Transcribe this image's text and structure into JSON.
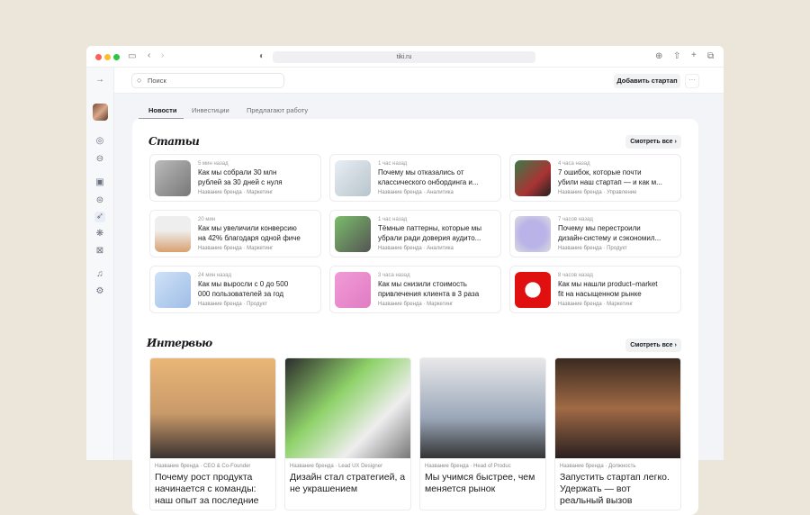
{
  "browser": {
    "url": "tiki.ru",
    "colors": {
      "close": "#ff5f57",
      "min": "#febc2e",
      "max": "#28c840"
    }
  },
  "topbar": {
    "search_placeholder": "Поиск",
    "add_startup": "Добавить стартап",
    "more": "···"
  },
  "tabs": [
    "Новости",
    "Инвестиции",
    "Предлагают работу"
  ],
  "articles": {
    "title": "Статьи",
    "see_all": "Смотреть все ›",
    "items": [
      {
        "time": "5 мин назад",
        "l1": "Как мы собрали 30 млн",
        "l2": "рублей за 30 дней с нуля",
        "brand": "Название бренда",
        "cat": "Маркетинг"
      },
      {
        "time": "1 час назад",
        "l1": "Почему мы отказались от",
        "l2": "классического онбординга и...",
        "brand": "Название бренда",
        "cat": "Аналитика"
      },
      {
        "time": "4 часа назад",
        "l1": "7 ошибок, которые почти",
        "l2": "убили наш стартап — и как м...",
        "brand": "Название бренда",
        "cat": "Управление"
      },
      {
        "time": "20 мин",
        "l1": "Как мы увеличили конверсию",
        "l2": "на 42% благодаря одной фиче",
        "brand": "Название бренда",
        "cat": "Маркетинг"
      },
      {
        "time": "1 час назад",
        "l1": "Тёмные паттерны, которые мы",
        "l2": "убрали ради доверия аудито...",
        "brand": "Название бренда",
        "cat": "Аналитика"
      },
      {
        "time": "7 часов назад",
        "l1": "Почему мы перестроили",
        "l2": "дизайн-систему и сэкономил...",
        "brand": "Название бренда",
        "cat": "Продукт"
      },
      {
        "time": "24 мин назад",
        "l1": "Как мы выросли с 0 до 500",
        "l2": "000 пользователей за год",
        "brand": "Название бренда",
        "cat": "Продукт"
      },
      {
        "time": "3 часа назад",
        "l1": "Как мы снизили стоимость",
        "l2": "привлечения клиента в 3 раза",
        "brand": "Название бренда",
        "cat": "Маркетинг"
      },
      {
        "time": "8 часов назад",
        "l1": "Как мы нашли product–market",
        "l2": "fit на насыщенном рынке",
        "brand": "Название бренда",
        "cat": "Маркетинг"
      }
    ]
  },
  "interviews": {
    "title": "Интервью",
    "see_all": "Смотреть все ›",
    "items": [
      {
        "meta": "Название бренда · CEO & Co-Founder",
        "title": "Почему рост продукта начинается с команды: наш опыт за последние д..."
      },
      {
        "meta": "Название бренда · Lead UX Designer",
        "title": "Дизайн стал стратегией, а не украшением"
      },
      {
        "meta": "Название бренда · Head of Produc",
        "title": "Мы учимся быстрее, чем меняется рынок"
      },
      {
        "meta": "Название бренда · Должность",
        "title": "Запустить стартап легко. Удержать — вот реальный вызов"
      }
    ]
  }
}
